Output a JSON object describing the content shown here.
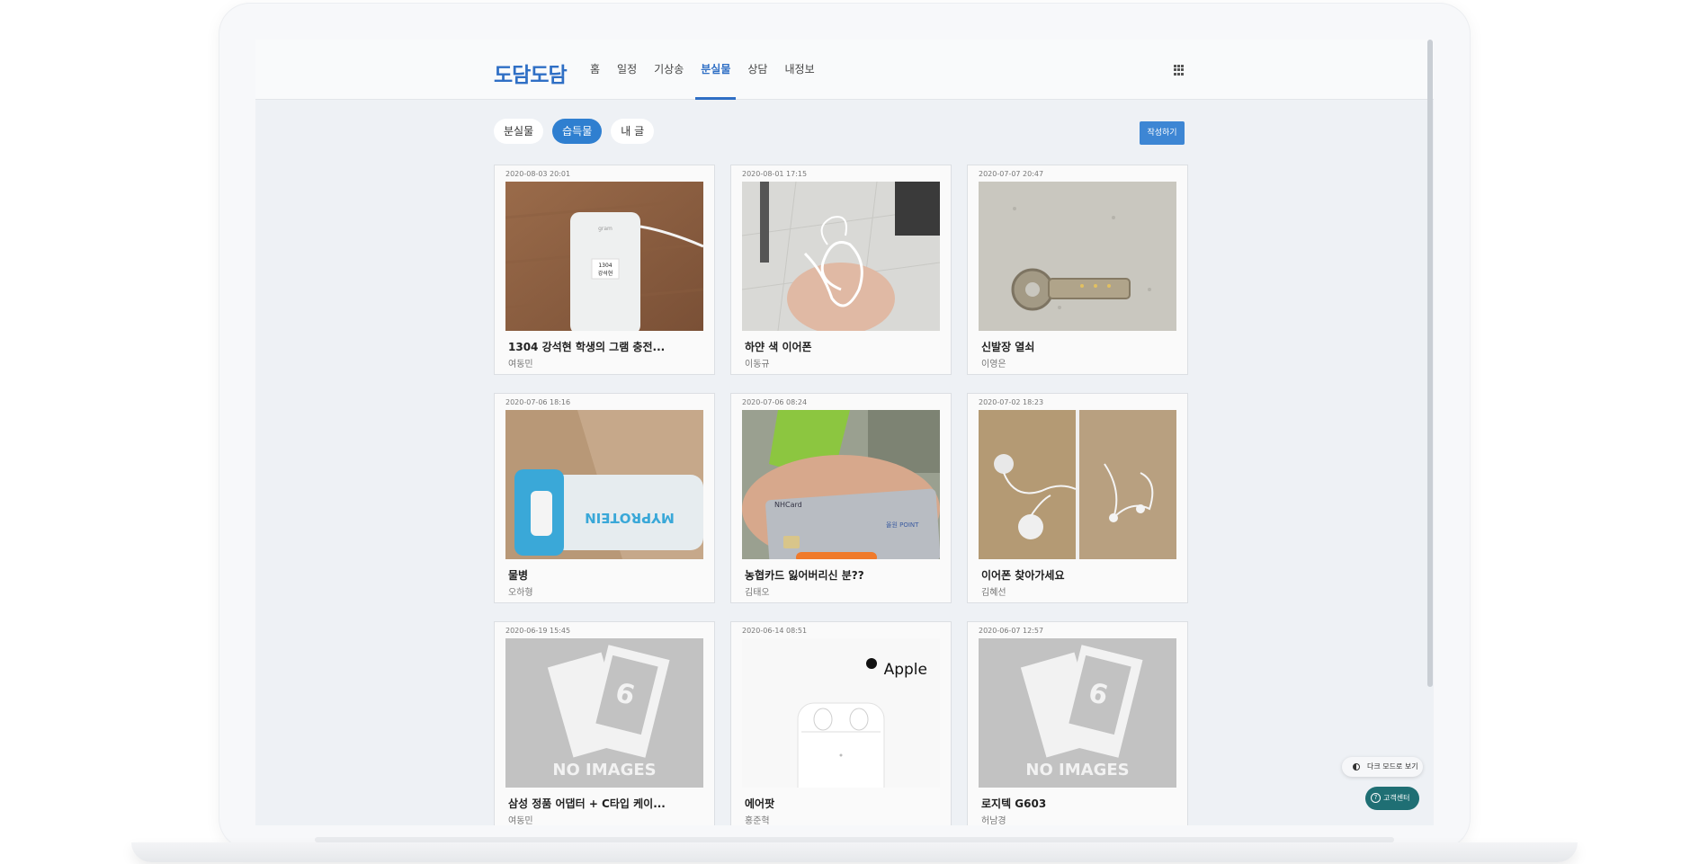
{
  "app": {
    "logo": "도담도담",
    "menu": [
      {
        "label": "홈",
        "active": false
      },
      {
        "label": "일정",
        "active": false
      },
      {
        "label": "기상송",
        "active": false
      },
      {
        "label": "분실물",
        "active": true
      },
      {
        "label": "상담",
        "active": false
      },
      {
        "label": "내정보",
        "active": false
      }
    ]
  },
  "filters": [
    {
      "label": "분실물",
      "active": false
    },
    {
      "label": "습득물",
      "active": true
    },
    {
      "label": "내 글",
      "active": false
    }
  ],
  "write_button": "작성하기",
  "cards": [
    {
      "date": "2020-08-03 20:01",
      "title": "1304 강석현 학생의 그램 충전...",
      "author": "여동민",
      "thumb": "charger"
    },
    {
      "date": "2020-08-01 17:15",
      "title": "하얀 색 이어폰",
      "author": "이동규",
      "thumb": "earphones-hand"
    },
    {
      "date": "2020-07-07 20:47",
      "title": "신발장 열쇠",
      "author": "이영은",
      "thumb": "key"
    },
    {
      "date": "2020-07-06 18:16",
      "title": "물병",
      "author": "오하형",
      "thumb": "bottle"
    },
    {
      "date": "2020-07-06 08:24",
      "title": "농협카드 잃어버리신 분??",
      "author": "김태오",
      "thumb": "card"
    },
    {
      "date": "2020-07-02 18:23",
      "title": "이어폰 찾아가세요",
      "author": "김혜선",
      "thumb": "earphones-floor"
    },
    {
      "date": "2020-06-19 15:45",
      "title": "삼성 정품 어댑터 + C타입 케이...",
      "author": "여동민",
      "thumb": "no-image"
    },
    {
      "date": "2020-06-14 08:51",
      "title": "에어팟",
      "author": "홍준혁",
      "thumb": "airpods"
    },
    {
      "date": "2020-06-07 12:57",
      "title": "로지텍 G603",
      "author": "허남경",
      "thumb": "no-image"
    }
  ],
  "image_text": {
    "charger_brand": "gram",
    "charger_label_1": "1304",
    "charger_label_2": "강석현",
    "bottle_brand": "MYPROTEIN",
    "card_brand": "NHCard",
    "card_sub": "올원 POINT",
    "airpods_brand": "Apple",
    "no_image": "NO IMAGES"
  },
  "floating": {
    "dark_mode": "다크 모드로 보기",
    "help": "고객센터"
  },
  "colors": {
    "accent": "#2f6fc5",
    "pill_active": "#2f7fd0",
    "help_button": "#1f6f74"
  }
}
